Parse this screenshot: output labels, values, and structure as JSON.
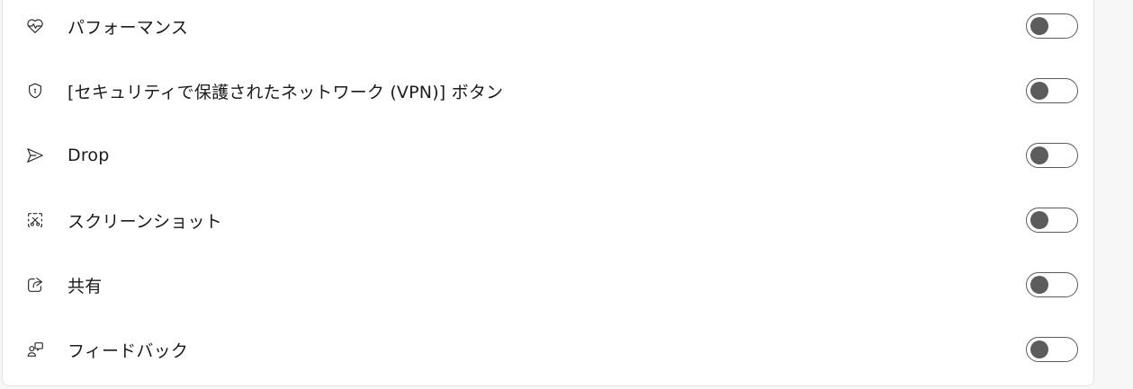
{
  "settings": {
    "items": [
      {
        "label": "パフォーマンス",
        "icon": "heartbeat-icon",
        "enabled": false
      },
      {
        "label": "[セキュリティで保護されたネットワーク (VPN)] ボタン",
        "icon": "shield-icon",
        "enabled": false
      },
      {
        "label": "Drop",
        "icon": "send-icon",
        "enabled": false
      },
      {
        "label": "スクリーンショット",
        "icon": "screenshot-icon",
        "enabled": false
      },
      {
        "label": "共有",
        "icon": "share-icon",
        "enabled": false
      },
      {
        "label": "フィードバック",
        "icon": "feedback-icon",
        "enabled": false
      }
    ]
  }
}
